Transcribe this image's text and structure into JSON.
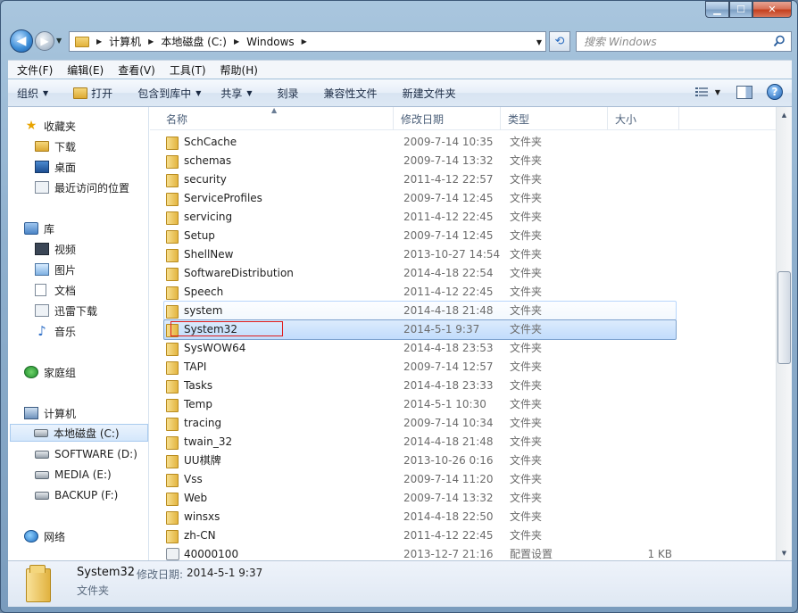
{
  "address": {
    "segments": [
      "计算机",
      "本地磁盘 (C:)",
      "Windows"
    ]
  },
  "search": {
    "placeholder": "搜索 Windows"
  },
  "menu": [
    "文件(F)",
    "编辑(E)",
    "查看(V)",
    "工具(T)",
    "帮助(H)"
  ],
  "commands": {
    "organize": "组织",
    "open": "打开",
    "include": "包含到库中",
    "share": "共享",
    "burn": "刻录",
    "compat": "兼容性文件",
    "newfolder": "新建文件夹"
  },
  "nav": {
    "favorites": "收藏夹",
    "downloads": "下载",
    "desktop": "桌面",
    "recent": "最近访问的位置",
    "libraries": "库",
    "videos": "视频",
    "pictures": "图片",
    "documents": "文档",
    "thunder": "迅雷下载",
    "music": "音乐",
    "homegroup": "家庭组",
    "computer": "计算机",
    "drive_c": "本地磁盘 (C:)",
    "drive_d": "SOFTWARE (D:)",
    "drive_e": "MEDIA (E:)",
    "drive_f": "BACKUP (F:)",
    "network": "网络"
  },
  "columns": {
    "name": "名称",
    "date": "修改日期",
    "type": "类型",
    "size": "大小"
  },
  "files": [
    {
      "name": "SchCache",
      "date": "2009-7-14 10:35",
      "type": "文件夹",
      "size": ""
    },
    {
      "name": "schemas",
      "date": "2009-7-14 13:32",
      "type": "文件夹",
      "size": ""
    },
    {
      "name": "security",
      "date": "2011-4-12 22:57",
      "type": "文件夹",
      "size": ""
    },
    {
      "name": "ServiceProfiles",
      "date": "2009-7-14 12:45",
      "type": "文件夹",
      "size": ""
    },
    {
      "name": "servicing",
      "date": "2011-4-12 22:45",
      "type": "文件夹",
      "size": ""
    },
    {
      "name": "Setup",
      "date": "2009-7-14 12:45",
      "type": "文件夹",
      "size": ""
    },
    {
      "name": "ShellNew",
      "date": "2013-10-27 14:54",
      "type": "文件夹",
      "size": ""
    },
    {
      "name": "SoftwareDistribution",
      "date": "2014-4-18 22:54",
      "type": "文件夹",
      "size": ""
    },
    {
      "name": "Speech",
      "date": "2011-4-12 22:45",
      "type": "文件夹",
      "size": ""
    },
    {
      "name": "system",
      "date": "2014-4-18 21:48",
      "type": "文件夹",
      "size": ""
    },
    {
      "name": "System32",
      "date": "2014-5-1 9:37",
      "type": "文件夹",
      "size": ""
    },
    {
      "name": "SysWOW64",
      "date": "2014-4-18 23:53",
      "type": "文件夹",
      "size": ""
    },
    {
      "name": "TAPI",
      "date": "2009-7-14 12:57",
      "type": "文件夹",
      "size": ""
    },
    {
      "name": "Tasks",
      "date": "2014-4-18 23:33",
      "type": "文件夹",
      "size": ""
    },
    {
      "name": "Temp",
      "date": "2014-5-1 10:30",
      "type": "文件夹",
      "size": ""
    },
    {
      "name": "tracing",
      "date": "2009-7-14 10:34",
      "type": "文件夹",
      "size": ""
    },
    {
      "name": "twain_32",
      "date": "2014-4-18 21:48",
      "type": "文件夹",
      "size": ""
    },
    {
      "name": "UU棋牌",
      "date": "2013-10-26 0:16",
      "type": "文件夹",
      "size": ""
    },
    {
      "name": "Vss",
      "date": "2009-7-14 11:20",
      "type": "文件夹",
      "size": ""
    },
    {
      "name": "Web",
      "date": "2009-7-14 13:32",
      "type": "文件夹",
      "size": ""
    },
    {
      "name": "winsxs",
      "date": "2014-4-18 22:50",
      "type": "文件夹",
      "size": ""
    },
    {
      "name": "zh-CN",
      "date": "2011-4-12 22:45",
      "type": "文件夹",
      "size": ""
    },
    {
      "name": "40000100",
      "date": "2013-12-7 21:16",
      "type": "配置设置",
      "size": "1 KB"
    }
  ],
  "details": {
    "name": "System32",
    "date_label": "修改日期:",
    "date": "2014-5-1 9:37",
    "type": "文件夹"
  },
  "icons": {
    "folder": "folder-icon",
    "config": "config-file-icon",
    "search": "search-icon"
  }
}
